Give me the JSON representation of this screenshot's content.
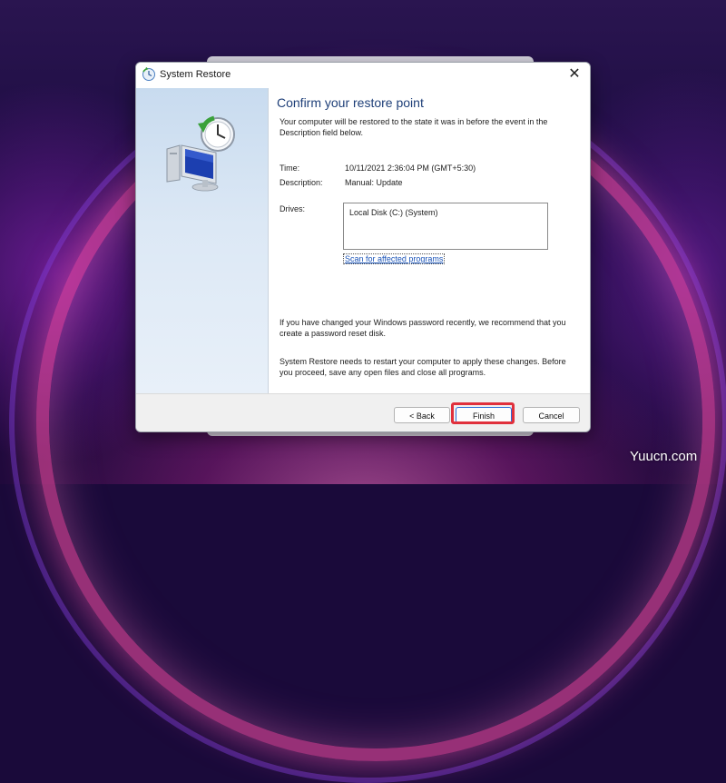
{
  "window": {
    "title": "System Restore",
    "close_symbol": "✕"
  },
  "main": {
    "heading": "Confirm your restore point",
    "intro": "Your computer will be restored to the state it was in before the event in the Description field below.",
    "time_label": "Time:",
    "time_value": "10/11/2021 2:36:04 PM (GMT+5:30)",
    "description_label": "Description:",
    "description_value": "Manual: Update",
    "drives_label": "Drives:",
    "drives": [
      "Local Disk (C:) (System)"
    ],
    "scan_link": "Scan for affected programs",
    "password_note": "If you have changed your Windows password recently, we recommend that you create a password reset disk.",
    "restart_note": "System Restore needs to restart your computer to apply these changes. Before you proceed, save any open files and close all programs."
  },
  "buttons": {
    "back": "< Back",
    "finish": "Finish",
    "cancel": "Cancel"
  },
  "watermark": "Yuucn.com",
  "colors": {
    "heading": "#1e3f78",
    "link": "#1c55b8",
    "highlight": "#e0303c"
  },
  "icons": {
    "title_icon": "system-restore-icon",
    "hero_icon": "computer-clock-restore-icon"
  }
}
